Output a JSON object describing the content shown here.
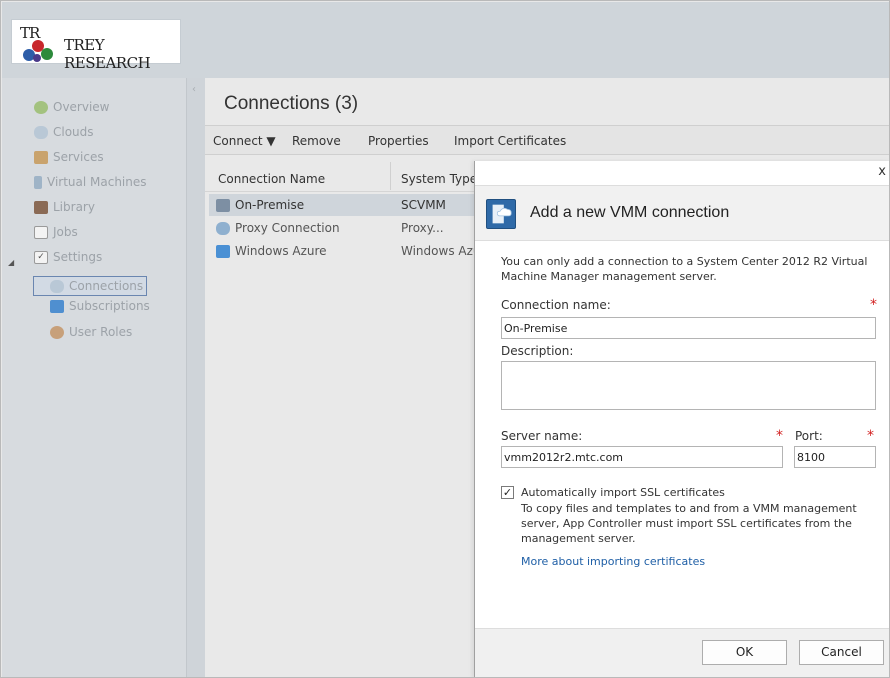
{
  "brand": {
    "logo_mark": "TR",
    "logo_text": "TREY RESEARCH"
  },
  "sidebar": {
    "items": [
      {
        "label": "Overview",
        "icon": "overview-icon"
      },
      {
        "label": "Clouds",
        "icon": "cloud-icon"
      },
      {
        "label": "Services",
        "icon": "services-icon"
      },
      {
        "label": "Virtual Machines",
        "icon": "vm-icon"
      },
      {
        "label": "Library",
        "icon": "library-icon"
      },
      {
        "label": "Jobs",
        "icon": "jobs-icon"
      },
      {
        "label": "Settings",
        "icon": "settings-icon"
      },
      {
        "label": "Connections",
        "icon": "connections-icon",
        "selected": true
      },
      {
        "label": "Subscriptions",
        "icon": "subscriptions-icon"
      },
      {
        "label": "User Roles",
        "icon": "user-roles-icon"
      }
    ]
  },
  "main": {
    "title": "Connections (3)",
    "toolbar": {
      "connect": "Connect ▼",
      "remove": "Remove",
      "properties": "Properties",
      "import_certificates": "Import Certificates"
    },
    "columns": [
      "Connection Name",
      "System Type"
    ],
    "rows": [
      {
        "name": "On-Premise",
        "type": "SCVMM",
        "icon": "scvmm-icon"
      },
      {
        "name": "Proxy Connection",
        "type": "Proxy...",
        "icon": "proxy-icon"
      },
      {
        "name": "Windows Azure",
        "type": "Windows Azur",
        "icon": "azure-icon"
      }
    ]
  },
  "dialog": {
    "close": "x",
    "title": "Add a new VMM connection",
    "note": "You can only add a connection to a System Center 2012 R2 Virtual Machine Manager management server.",
    "connection_name_label": "Connection name:",
    "connection_name_value": "On-Premise",
    "description_label": "Description:",
    "description_value": "",
    "server_name_label": "Server name:",
    "server_name_value": "vmm2012r2.mtc.com",
    "port_label": "Port:",
    "port_value": "8100",
    "required_mark": "*",
    "ssl_checkbox_checked": true,
    "ssl_checkbox_label": "Automatically import SSL certificates",
    "ssl_description": "To copy files and templates to and from a VMM management server, App Controller must import SSL certificates from the management server.",
    "link": "More about importing certificates",
    "ok": "OK",
    "cancel": "Cancel"
  },
  "colors": {
    "accent": "#1f5fa6",
    "required": "#d21f1f",
    "selection": "#cfd5db"
  }
}
